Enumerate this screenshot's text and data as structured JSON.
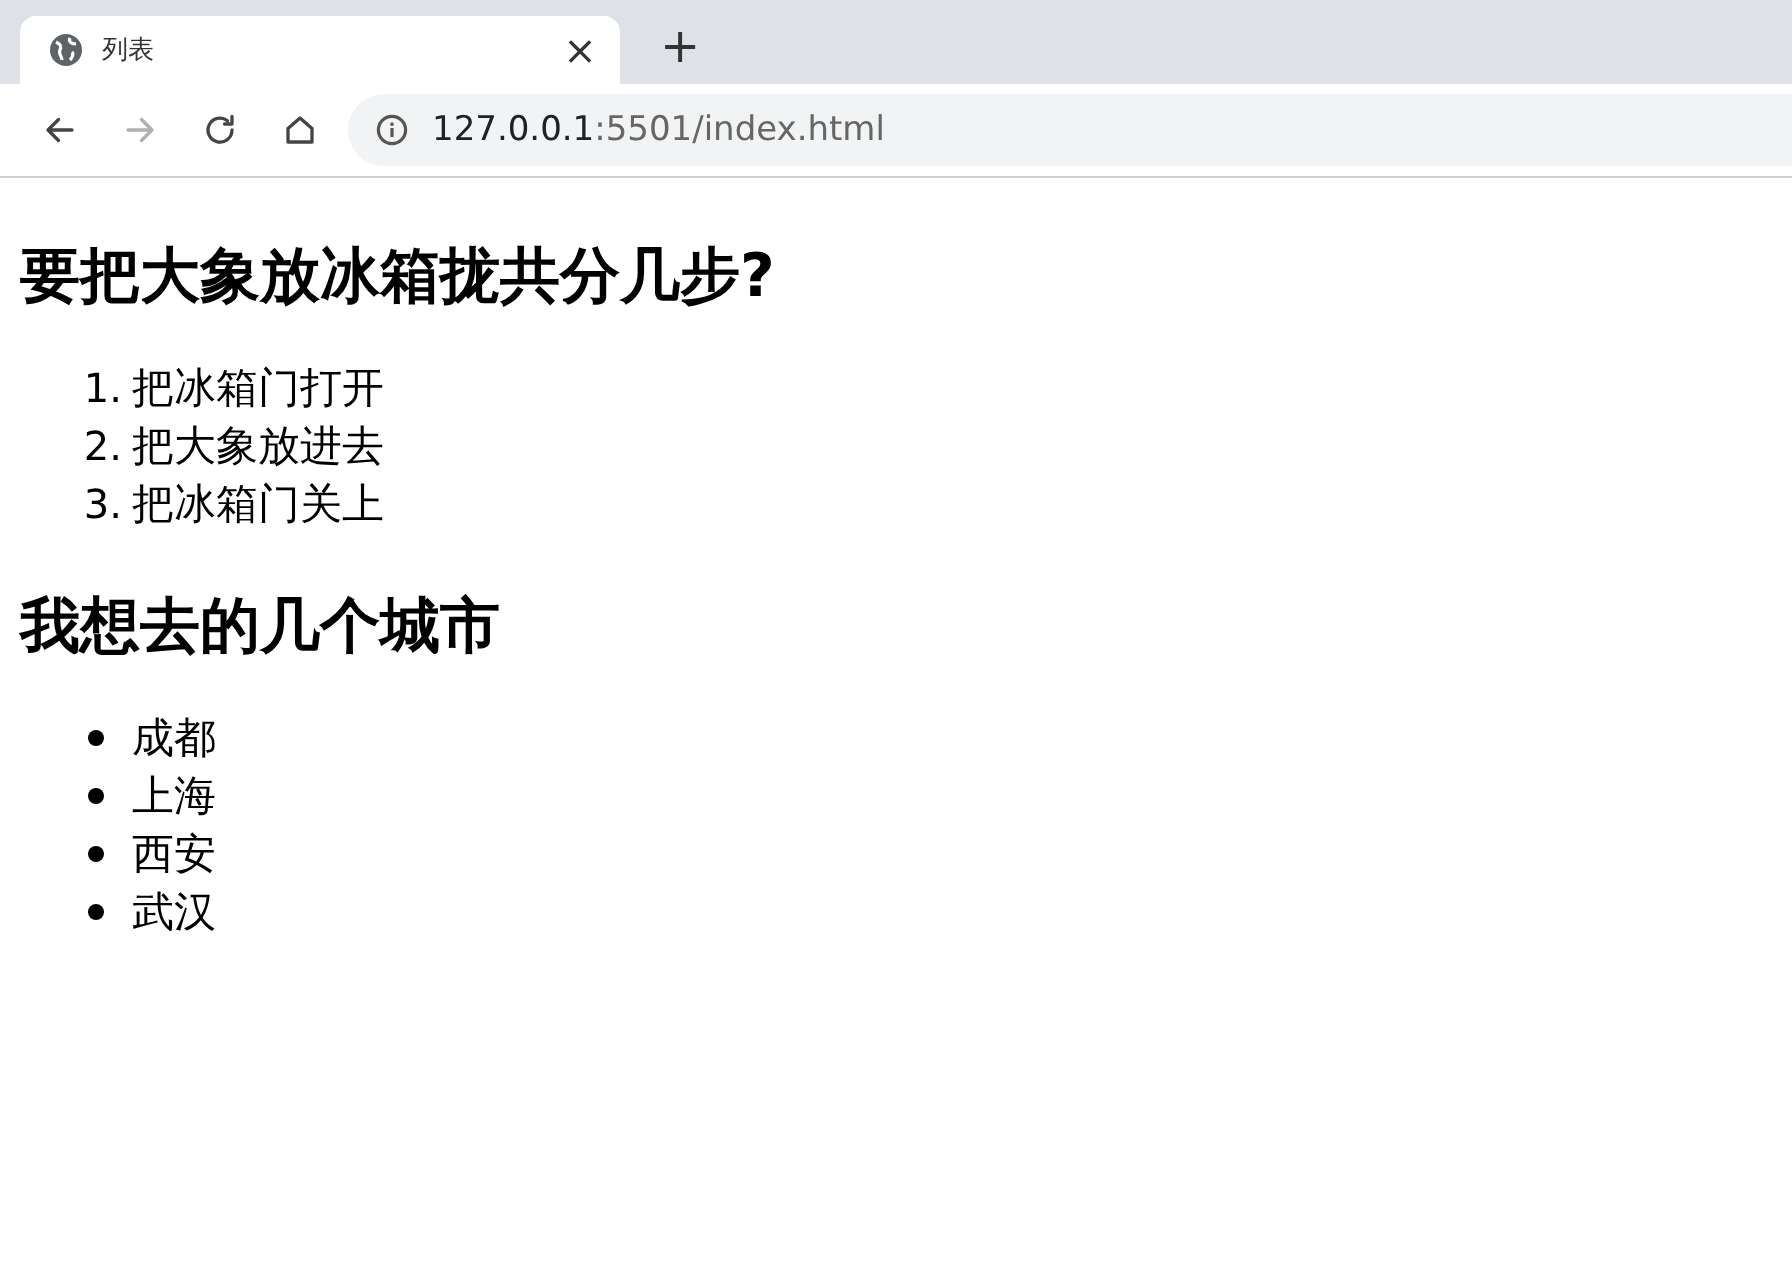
{
  "tab": {
    "title": "列表",
    "close": "×",
    "selected": true
  },
  "new_tab": "+",
  "toolbar": {
    "forward_disabled": true
  },
  "address": {
    "host": "127.0.0.1",
    "rest": ":5501/index.html"
  },
  "sections": [
    {
      "heading": "要把大象放冰箱拢共分几步?",
      "kind": "ordered",
      "items": [
        {
          "marker": "1.",
          "text": "把冰箱门打开"
        },
        {
          "marker": "2.",
          "text": "把大象放进去"
        },
        {
          "marker": "3.",
          "text": "把冰箱门关上"
        }
      ]
    },
    {
      "heading": "我想去的几个城市",
      "kind": "bullets",
      "items": [
        {
          "text": "成都"
        },
        {
          "text": "上海"
        },
        {
          "text": "西安"
        },
        {
          "text": "武汉"
        }
      ]
    }
  ]
}
